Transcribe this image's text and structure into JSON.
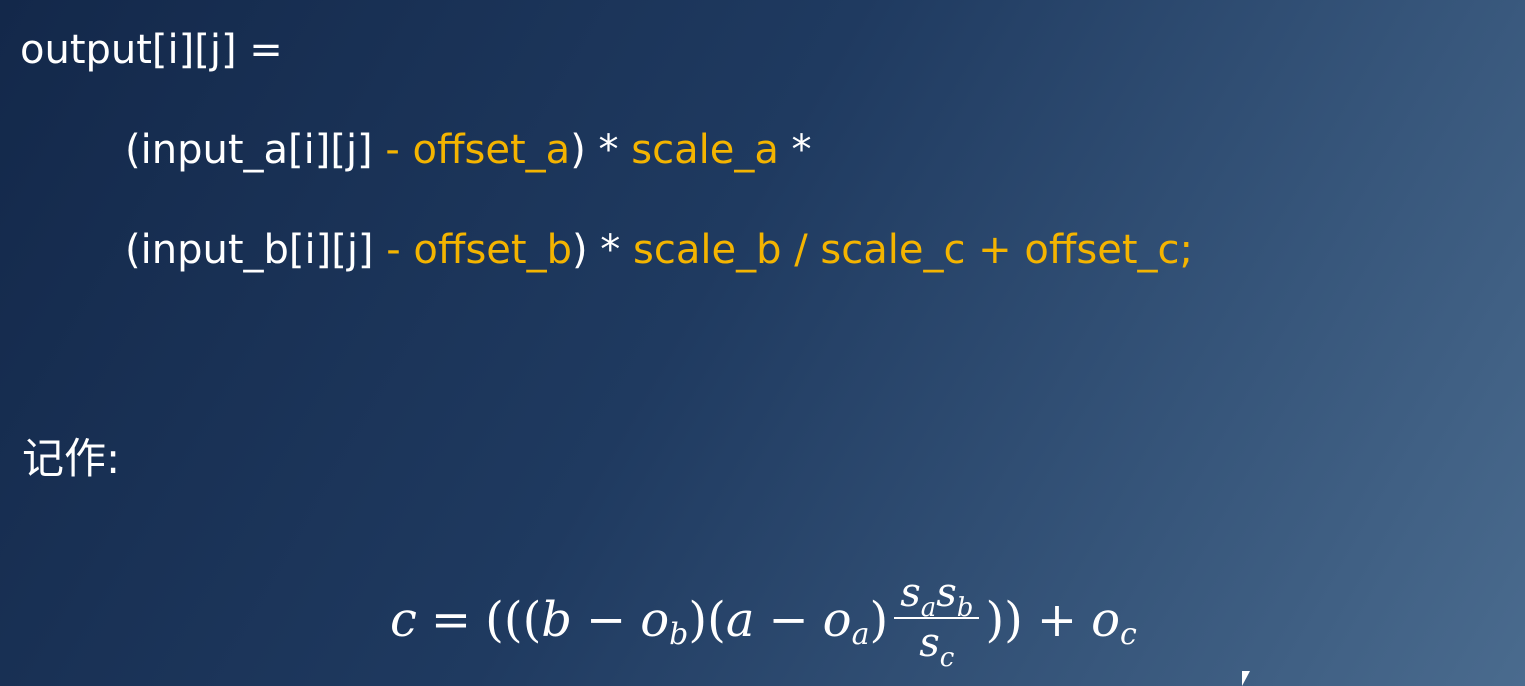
{
  "code": {
    "line0": "output[i][j] =",
    "line1": {
      "t1": "(input_a[i][j]",
      "t2": " - offset_a",
      "t3": ") * ",
      "t4": "scale_a",
      "t5": " *"
    },
    "line2": {
      "t1": "(input_b[i][j]",
      "t2": " - offset_b",
      "t3": ") * ",
      "t4": "scale_b / scale_c + offset_c;"
    }
  },
  "label": "记作:",
  "formula": {
    "c": "c",
    "eq": "=",
    "open": "(((",
    "b": "b",
    "minus": "−",
    "o": "o",
    "sub_b": "b",
    "close_mid": ")(",
    "a": "a",
    "sub_a": "a",
    "close_a": ")",
    "s": "s",
    "frac_num_sub1": "a",
    "frac_num_sub2": "b",
    "frac_den_sub": "c",
    "close_end": "))",
    "plus": "+",
    "sub_c": "c"
  },
  "colors": {
    "highlight": "#f4b400",
    "text": "#ffffff",
    "background_dark": "#13284a",
    "background_light": "#4a6b8e"
  }
}
